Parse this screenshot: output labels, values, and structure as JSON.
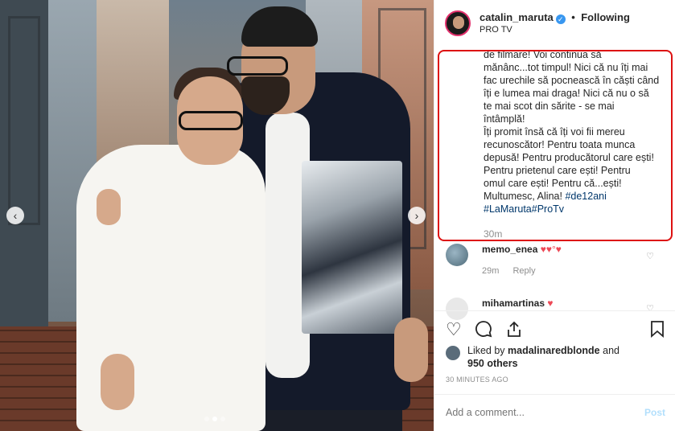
{
  "header": {
    "username": "catalin_maruta",
    "verified_mark": "✓",
    "separator": "•",
    "follow_status": "Following",
    "subtitle": "PRO TV"
  },
  "caption": {
    "lines": [
      "de filmare! Voi continua să",
      "mănânc...tot timpul! Nici că nu îți mai",
      "fac urechile să pocnească în căști când",
      "îți e lumea mai draga! Nici că nu o să",
      "te mai scot din sărite - se mai",
      "întâmplă!",
      "Îți promit însă că îți voi fii mereu",
      "recunoscător! Pentru toata munca",
      "depusă! Pentru producătorul care ești!",
      "Pentru prietenul care ești! Pentru",
      "omul care ești! Pentru că...ești!"
    ],
    "last_line_text": "Multumesc, Alina! ",
    "hashtag1": "#de12ani",
    "hashtag2": "#LaMaruta",
    "hashtag3": "#ProTv",
    "time": "30m"
  },
  "comments": [
    {
      "user": "memo_enea",
      "text": "♥♥°♥",
      "time": "29m",
      "reply": "Reply"
    },
    {
      "user": "mihamartinas",
      "text": "♥"
    }
  ],
  "actions": {
    "like_icon": "heart-outline",
    "comment_icon": "speech-bubble",
    "share_icon": "share-arrow",
    "save_icon": "bookmark"
  },
  "likes": {
    "prefix": "Liked by ",
    "user": "madalinaredblonde",
    "middle": " and",
    "count": "950 others"
  },
  "posted_ago": "30 MINUTES AGO",
  "add_comment": {
    "placeholder": "Add a comment...",
    "post_label": "Post"
  },
  "carousel": {
    "prev": "‹",
    "next": "›"
  },
  "colors": {
    "verified": "#3897f0",
    "highlight_border": "#dd1111",
    "hashtag": "#00376b",
    "heart": "#ed4956",
    "post_disabled": "#b2dffc"
  }
}
